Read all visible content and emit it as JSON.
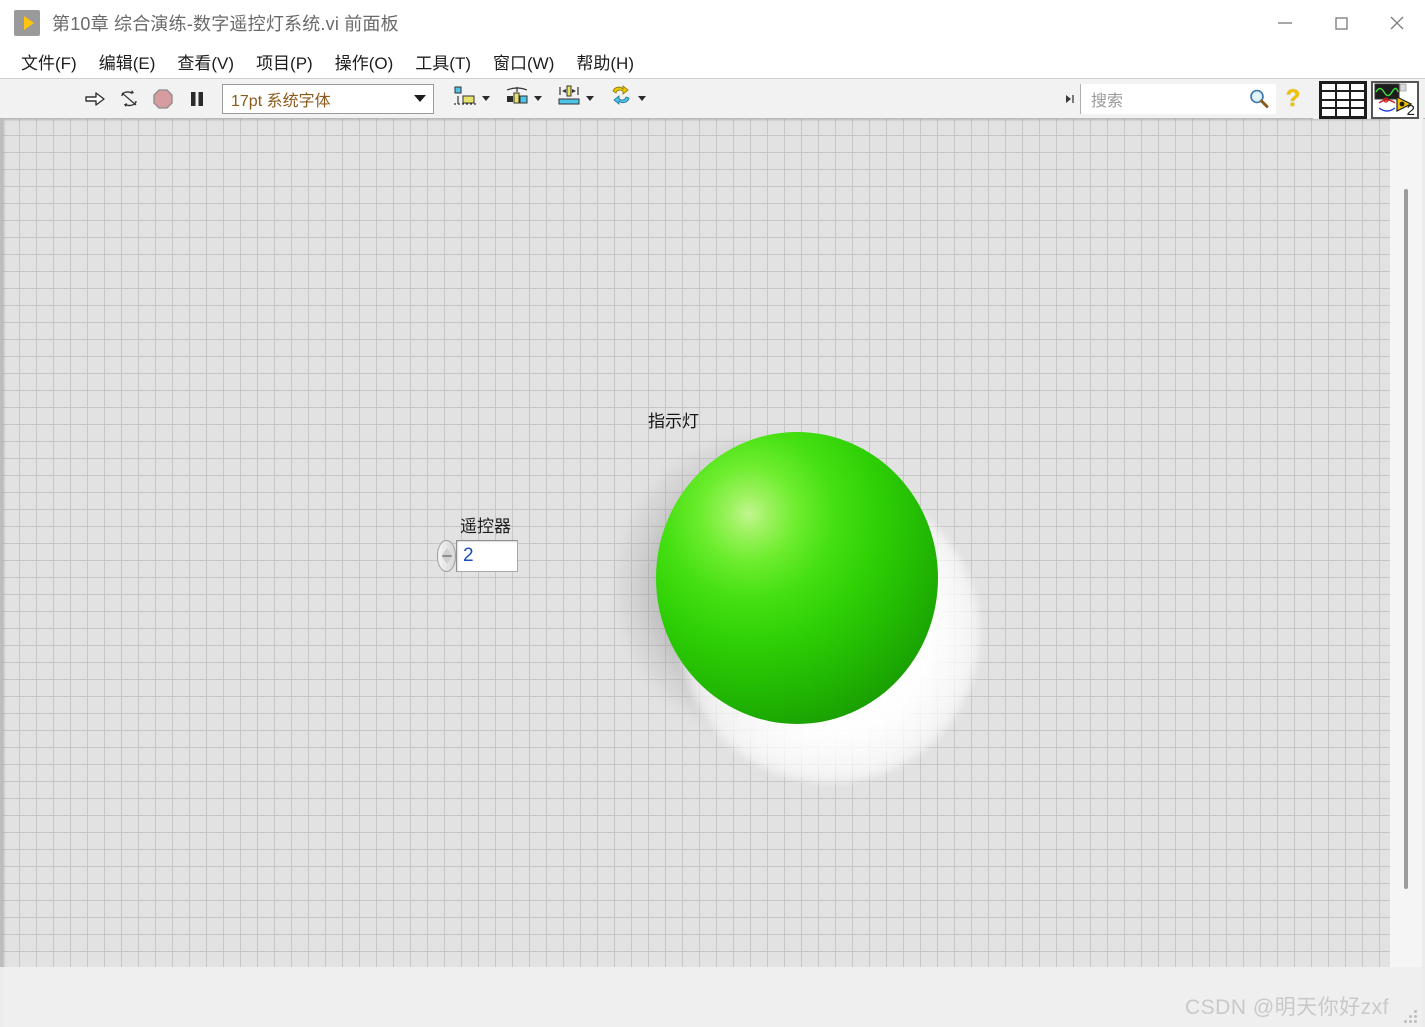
{
  "window": {
    "title": "第10章 综合演练-数字遥控灯系统.vi 前面板",
    "app_icon": "labview-vi-icon",
    "controls": {
      "minimize": "minimize-icon",
      "maximize": "maximize-icon",
      "close": "close-icon"
    }
  },
  "menubar": {
    "items": [
      {
        "label": "文件(F)"
      },
      {
        "label": "编辑(E)"
      },
      {
        "label": "查看(V)"
      },
      {
        "label": "项目(P)"
      },
      {
        "label": "操作(O)"
      },
      {
        "label": "工具(T)"
      },
      {
        "label": "窗口(W)"
      },
      {
        "label": "帮助(H)"
      }
    ]
  },
  "toolbar": {
    "run_icon": "run-arrow-icon",
    "run_continuous_icon": "run-continuously-icon",
    "abort_icon": "abort-execution-icon",
    "pause_icon": "pause-icon",
    "font_selector": {
      "value": "17pt 系统字体",
      "caret": "chevron-down-icon"
    },
    "align_objects_icon": "align-objects-icon",
    "distribute_objects_icon": "distribute-objects-icon",
    "resize_objects_icon": "resize-objects-icon",
    "reorder_icon": "reorder-objects-icon",
    "search": {
      "placeholder": "搜索",
      "expand_icon": "expand-arrow-icon",
      "search_icon": "magnifier-icon"
    },
    "help_icon": "help-question-icon",
    "connector_pane_icon": "connector-pane-icon",
    "vi_icon": "vi-thumbnail-icon",
    "vi_icon_number": "2"
  },
  "panel": {
    "numeric_control": {
      "label": "遥控器",
      "value": "2",
      "increment_icon": "increment-up-icon",
      "decrement_icon": "decrement-down-icon"
    },
    "led_indicator": {
      "label": "指示灯",
      "state": "on",
      "color_on": "#2fd106",
      "color_highlight": "#c2f590",
      "color_edge": "#127d00"
    }
  },
  "scrollbars": {
    "vertical": "vertical-scrollbar",
    "horizontal": "horizontal-scrollbar"
  },
  "watermark": {
    "text": "CSDN @明天你好zxf"
  }
}
